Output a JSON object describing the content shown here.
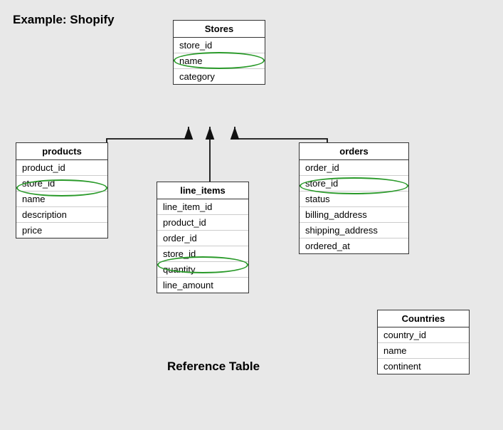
{
  "diagram": {
    "example_label": "Example: Shopify",
    "reference_label": "Reference Table",
    "tables": {
      "stores": {
        "title": "Stores",
        "fields": [
          "store_id",
          "name",
          "category"
        ]
      },
      "products": {
        "title": "products",
        "fields": [
          "product_id",
          "store_id",
          "name",
          "description",
          "price"
        ]
      },
      "line_items": {
        "title": "line_items",
        "fields": [
          "line_item_id",
          "product_id",
          "order_id",
          "store_id",
          "quantity",
          "line_amount"
        ]
      },
      "orders": {
        "title": "orders",
        "fields": [
          "order_id",
          "store_id",
          "status",
          "billing_address",
          "shipping_address",
          "ordered_at"
        ]
      },
      "countries": {
        "title": "Countries",
        "fields": [
          "country_id",
          "name",
          "continent"
        ]
      }
    }
  }
}
